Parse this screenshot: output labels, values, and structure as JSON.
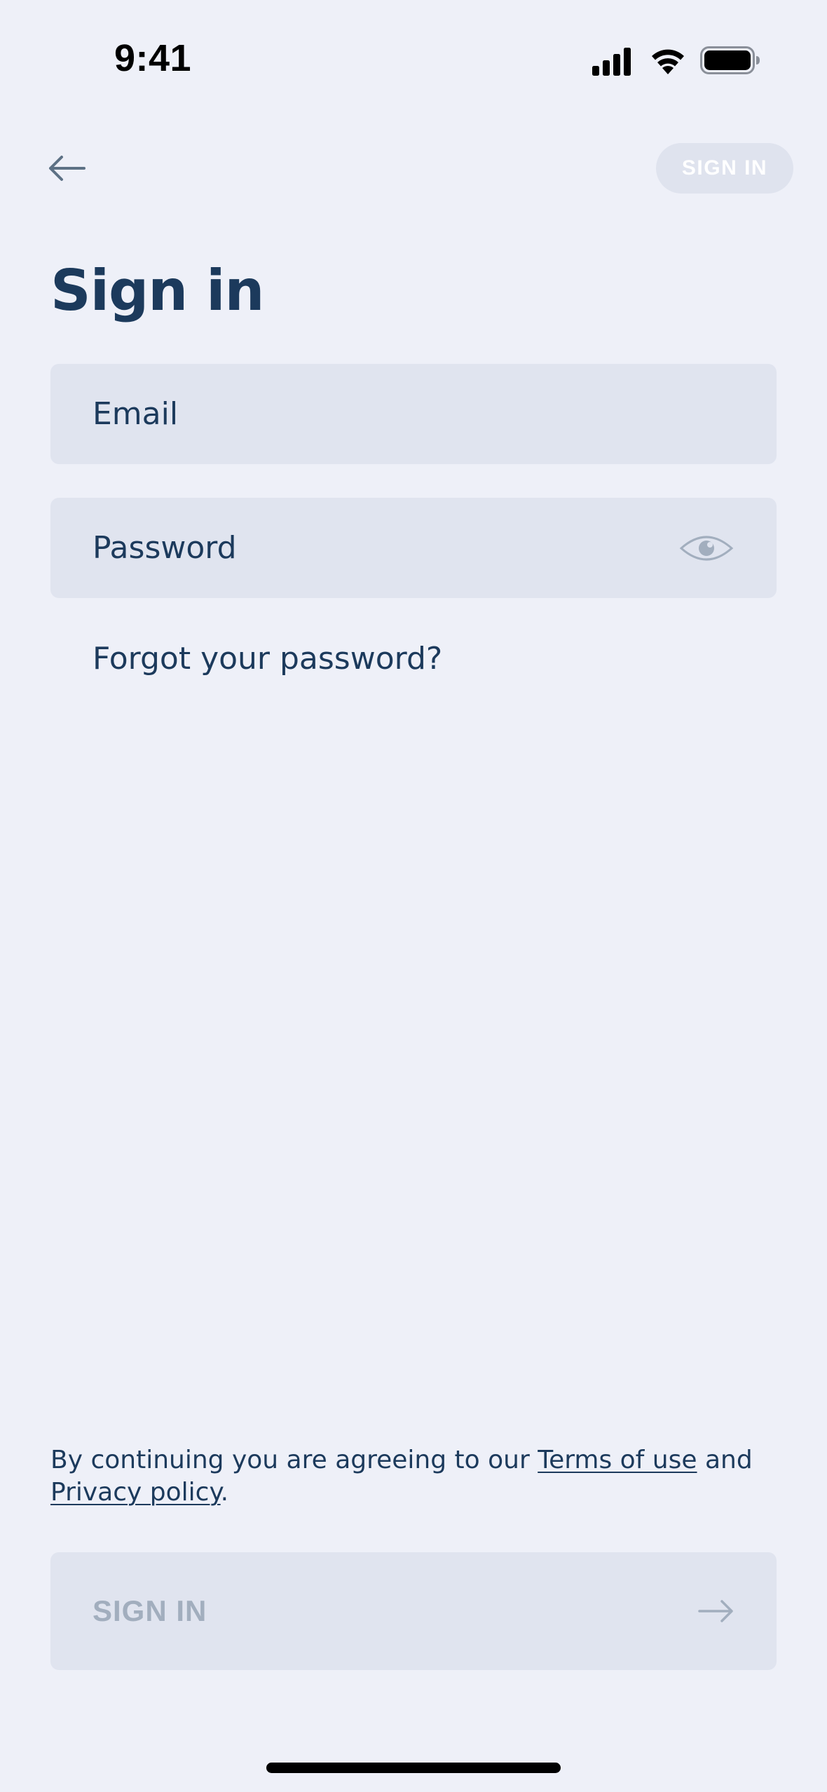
{
  "status_bar": {
    "time": "9:41",
    "icons": [
      "cellular-signal-icon",
      "wifi-icon",
      "battery-icon"
    ]
  },
  "header": {
    "back_icon": "arrow-left-icon",
    "sign_in_label": "SIGN IN"
  },
  "page": {
    "title": "Sign in"
  },
  "form": {
    "email_placeholder": "Email",
    "password_placeholder": "Password",
    "password_toggle_icon": "eye-icon",
    "forgot_password_label": "Forgot your password?"
  },
  "legal": {
    "prefix": "By continuing you are agreeing to our ",
    "terms_label": "Terms of use",
    "conjunction": " and ",
    "privacy_label": "Privacy policy",
    "suffix": "."
  },
  "footer": {
    "sign_in_label": "SIGN IN",
    "sign_in_icon": "arrow-right-icon"
  },
  "colors": {
    "background": "#eef0f8",
    "text_primary": "#1c3a5c",
    "field_background": "#e0e4ef",
    "disabled_text": "#a2aebe"
  }
}
